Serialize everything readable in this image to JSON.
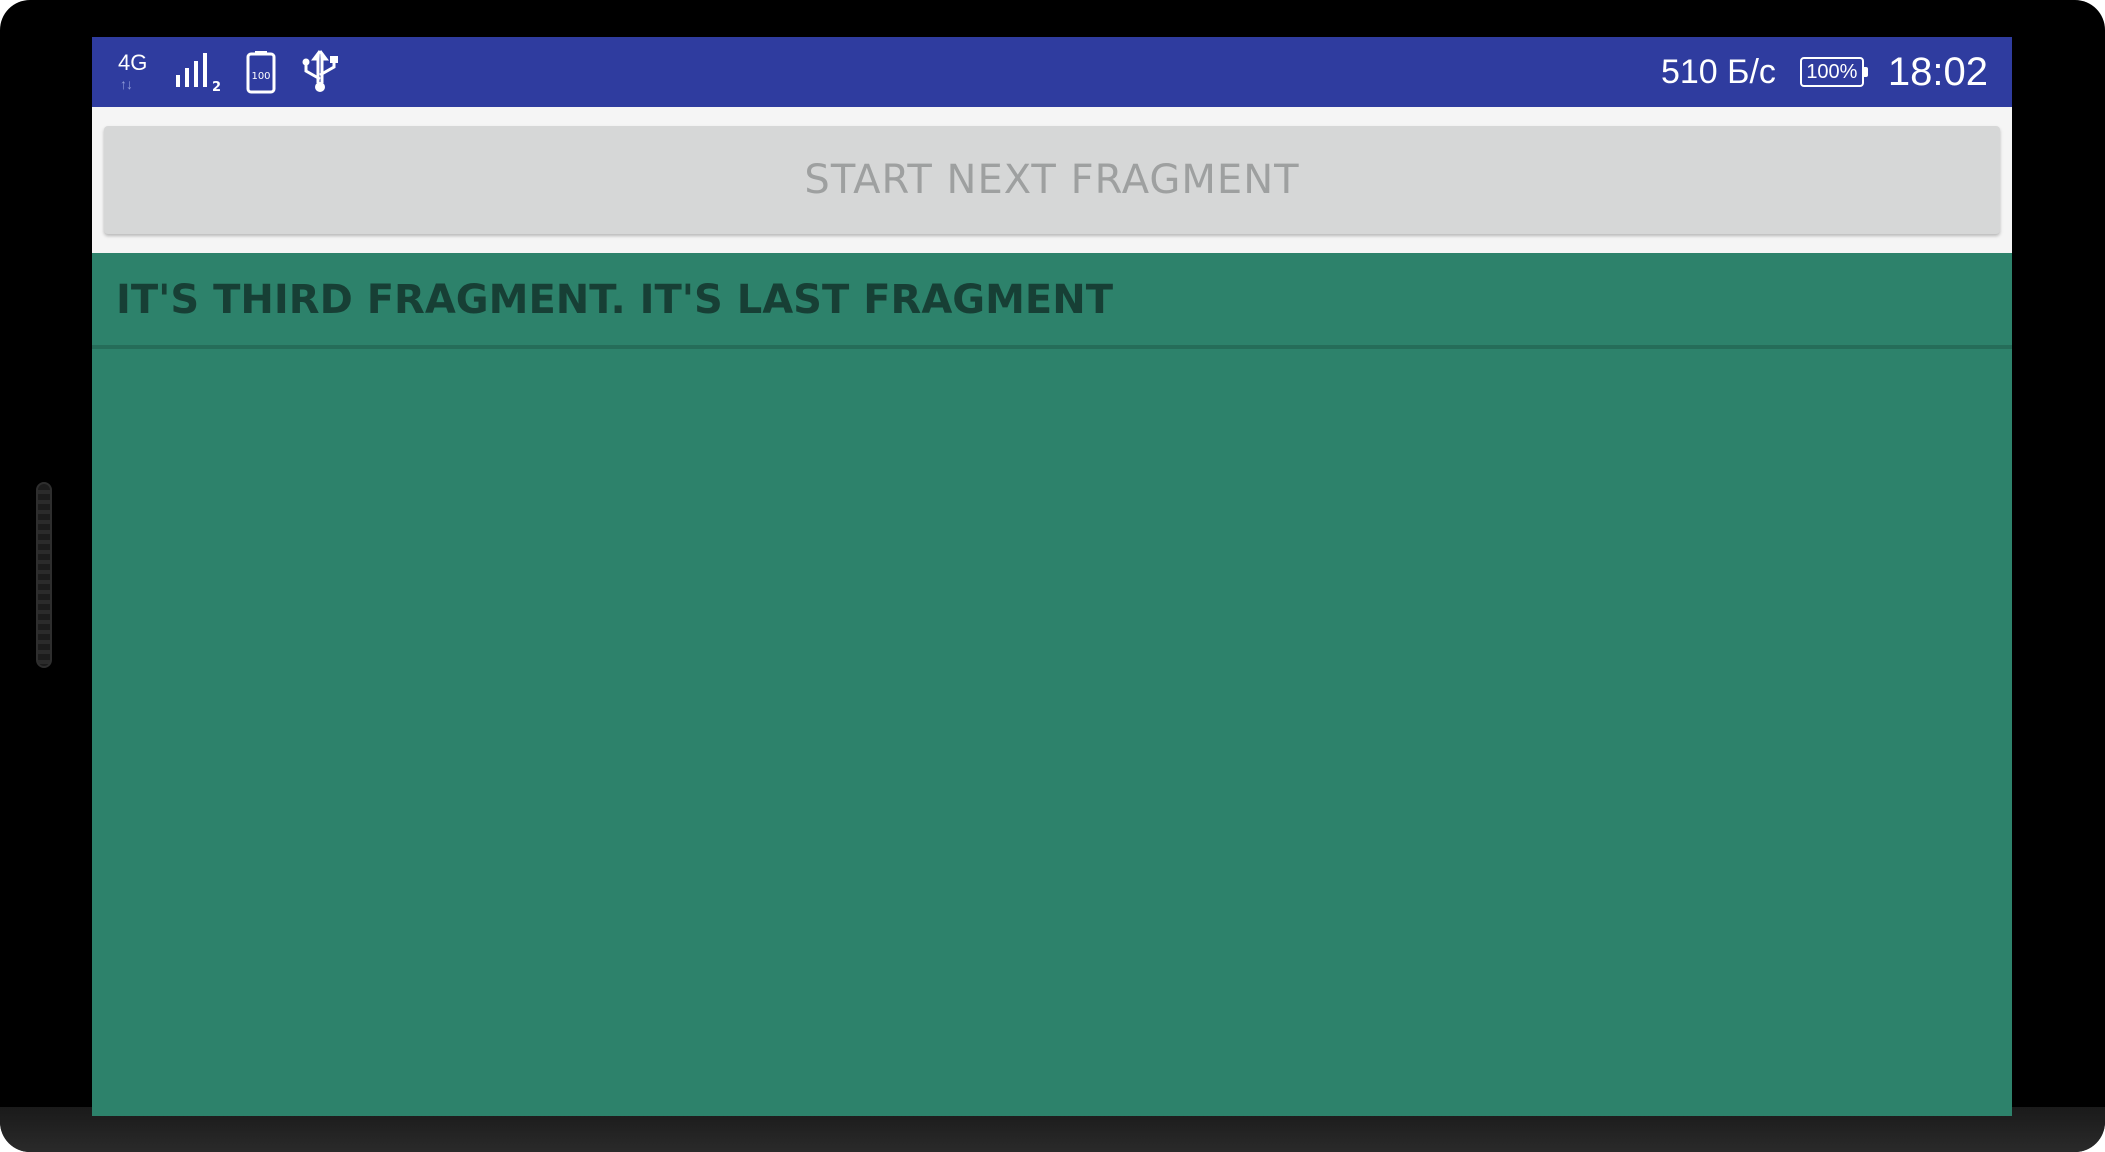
{
  "status_bar": {
    "network_type": "4G",
    "network_activity": "↑↓",
    "signal_sim_index": "2",
    "battery_icon_level": "100",
    "net_speed": "510 Б/с",
    "battery_percent": "100%",
    "time": "18:02",
    "icons": [
      "network-4g-icon",
      "signal-strength-icon",
      "battery-icon",
      "usb-icon"
    ],
    "background_color": "#2f3c9f"
  },
  "toolbar": {
    "start_next_label": "START NEXT FRAGMENT"
  },
  "fragment": {
    "title": "IT'S THIRD FRAGMENT. IT'S LAST FRAGMENT",
    "background_color": "#2d826b",
    "title_color": "#173f35"
  }
}
